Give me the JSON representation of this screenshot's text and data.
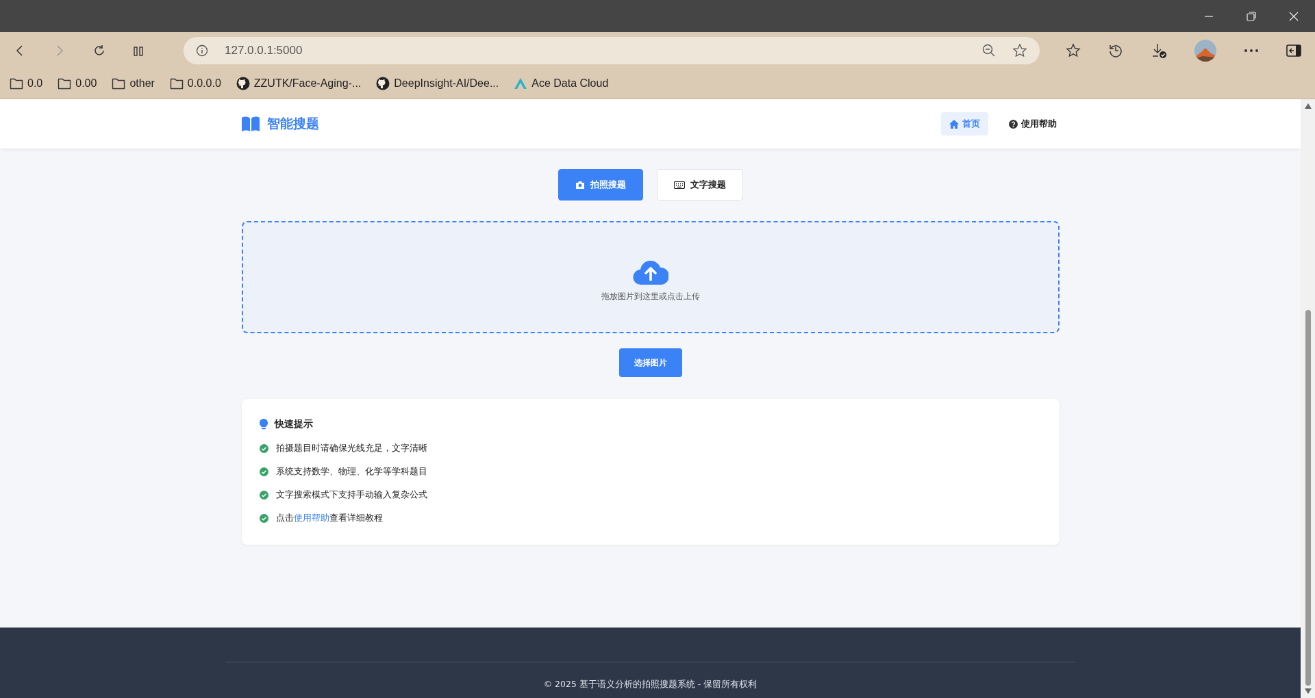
{
  "browser": {
    "address": "127.0.0.1:5000",
    "bookmarks": [
      {
        "kind": "folder",
        "label": "0.0"
      },
      {
        "kind": "folder",
        "label": "0.00"
      },
      {
        "kind": "folder",
        "label": "other"
      },
      {
        "kind": "folder",
        "label": "0.0.0.0"
      },
      {
        "kind": "github",
        "label": "ZZUTK/Face-Aging-..."
      },
      {
        "kind": "github",
        "label": "DeepInsight-AI/Dee..."
      },
      {
        "kind": "ace",
        "label": "Ace Data Cloud"
      }
    ]
  },
  "header": {
    "brand": "智能搜题",
    "nav": [
      {
        "label": "首页",
        "selected": true
      },
      {
        "label": "使用帮助",
        "selected": false
      }
    ]
  },
  "modes": [
    {
      "label": "拍照搜题",
      "selected": true
    },
    {
      "label": "文字搜题",
      "selected": false
    }
  ],
  "upload": {
    "hint": "拖放图片到这里或点击上传",
    "button": "选择图片"
  },
  "tips": {
    "title": "快速提示",
    "items": [
      {
        "text": "拍摄题目时请确保光线充足，文字清晰"
      },
      {
        "text": "系统支持数学、物理、化学等学科题目"
      },
      {
        "text": "文字搜索模式下支持手动输入复杂公式"
      },
      {
        "before": "点击",
        "link": "使用帮助",
        "after": "查看详细教程"
      }
    ]
  },
  "footer": {
    "text": "© 2025 基于语义分析的拍照搜题系统 - 保留所有权利"
  }
}
